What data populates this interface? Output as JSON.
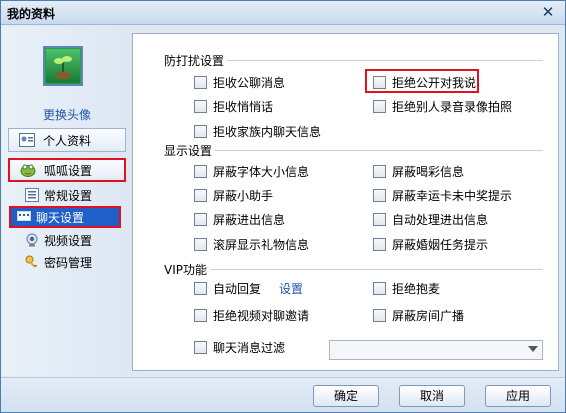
{
  "window": {
    "title": "我的资料",
    "close_symbol": "✕"
  },
  "sidebar": {
    "change_avatar": "更换头像",
    "profile_label": "个人资料",
    "gaga_label": "呱呱设置",
    "sub_items": {
      "general": "常规设置",
      "chat": "聊天设置",
      "video": "视频设置",
      "password": "密码管理"
    },
    "icons": {
      "avatar": "sprout-avatar-icon",
      "profile": "id-card-icon",
      "gaga": "frog-icon",
      "general": "list-icon",
      "chat": "chat-icon",
      "video": "webcam-icon",
      "password": "key-icon"
    }
  },
  "sections": {
    "anti_disturb": {
      "title": "防打扰设置",
      "options": {
        "reject_public_chat": "拒收公聊消息",
        "reject_public_to_me": "拒绝公开对我说",
        "reject_whisper": "拒收悄悄话",
        "reject_record_photo": "拒绝别人录音录像拍照",
        "reject_family_chat": "拒收家族内聊天信息"
      }
    },
    "display": {
      "title": "显示设置",
      "options": {
        "block_font_size": "屏蔽字体大小信息",
        "block_cheer": "屏蔽喝彩信息",
        "block_assistant": "屏蔽小助手",
        "block_lucky_card": "屏蔽幸运卡未中奖提示",
        "block_enter_exit": "屏蔽进出信息",
        "auto_enter_exit": "自动处理进出信息",
        "scroll_gift": "滚屏显示礼物信息",
        "block_marriage_task": "屏蔽婚姻任务提示"
      }
    },
    "vip": {
      "title": "VIP功能",
      "options": {
        "auto_reply": "自动回复",
        "auto_reply_settings": "设置",
        "reject_hug_mic": "拒绝抱麦",
        "reject_video_invite": "拒绝视频对聊邀请",
        "block_room_broadcast": "屏蔽房间广播",
        "chat_filter": "聊天消息过滤"
      },
      "filter_dropdown_value": ""
    }
  },
  "footer": {
    "ok": "确定",
    "cancel": "取消",
    "apply": "应用"
  },
  "colors": {
    "highlight": "#e0121f",
    "selected": "#1f5fc7",
    "link": "#1f55a8"
  }
}
